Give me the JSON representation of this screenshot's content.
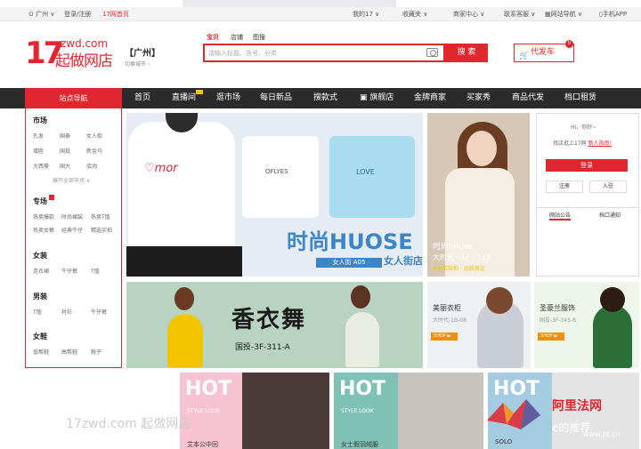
{
  "topbar": {
    "location": "广州",
    "login_register": "登录/注册",
    "home": "17网首页",
    "my17": "我的17",
    "favorites": "收藏夹",
    "merchant_center": "商家中心",
    "contact_service": "联系客服",
    "site_nav": "网站导航",
    "mobile_app": "手机APP"
  },
  "header": {
    "logo_num": "17",
    "logo_domain": "zwd.com",
    "logo_cn": "起做网店",
    "city": "【广州】",
    "city_switch": "切换城市 ›",
    "search_tabs": [
      "宝贝",
      "店铺",
      "图搜"
    ],
    "search_placeholder": "请输入标题、货号、分类",
    "search_button": "搜 索",
    "cart_label": "代发车",
    "cart_count": "0"
  },
  "nav": {
    "side_title": "站点导航",
    "items": [
      "首页",
      "直播间",
      "逛市场",
      "每日新品",
      "搜款式",
      "旗舰店",
      "金牌商家",
      "买家秀",
      "商品代发",
      "档口租赁"
    ]
  },
  "sidebar": {
    "market_title": "市场",
    "markets": [
      "孔发",
      "国泰",
      "女人街",
      "增胜",
      "国投",
      "新金马",
      "大西豪",
      "国大",
      "佰润"
    ],
    "expand_all": "展开全部市场 ∨",
    "special_title": "专场",
    "specials": [
      "热卖爆款",
      "时尚裙装",
      "热卖T恤",
      "热卖女裤",
      "经典牛仔",
      "精选实拍"
    ],
    "women_title": "女装",
    "women": [
      "连衣裙",
      "牛仔裤",
      "T恤"
    ],
    "men_title": "男装",
    "men": [
      "T恤",
      "衬衫",
      "牛仔裤"
    ],
    "shoes_title": "女鞋",
    "shoes": [
      "低帮鞋",
      "高帮鞋",
      "靴子"
    ]
  },
  "banner": {
    "headline": "时尚HUOSE",
    "tag": "女人街 A05",
    "tag2": "女人街店"
  },
  "promo_model": {
    "title": "时尚house",
    "sub": "大时代 - 1F - 115",
    "note": "#全店实拍 · 品质保证"
  },
  "user_panel": {
    "greeting": "Hi，你好~",
    "message_prefix": "找店逛上17网",
    "message_link": "新人指南!",
    "login": "登录",
    "register": "注册",
    "enter": "入驻",
    "tab_announcement": "网站公告",
    "tab_stall": "档口通知"
  },
  "xyw_banner": {
    "title": "香衣舞",
    "address": "国投-3F-311-A"
  },
  "ads": [
    {
      "title": "美丽衣柜",
      "sub": "大时代-1B-08",
      "shop": "SHOP ▶"
    },
    {
      "title": "圣豪兰服饰",
      "sub": "国投-3F-345-B",
      "shop": "SHOP ▶"
    }
  ],
  "bottom": {
    "hot": "HOT",
    "style": "STYLE LOOK",
    "caption1": "艾本公中回",
    "caption2": "女士假羽绒服",
    "solo": "SOLO",
    "watermark": "17zwd.com 起做网店",
    "wm_text": "e的推荐",
    "wm_url": "www.pt.cn",
    "wm_brand": "阿里法网"
  },
  "colors": {
    "brand_red": "#e0262f",
    "nav_dark": "#2b2b2b",
    "accent_blue": "#3c86c8"
  }
}
